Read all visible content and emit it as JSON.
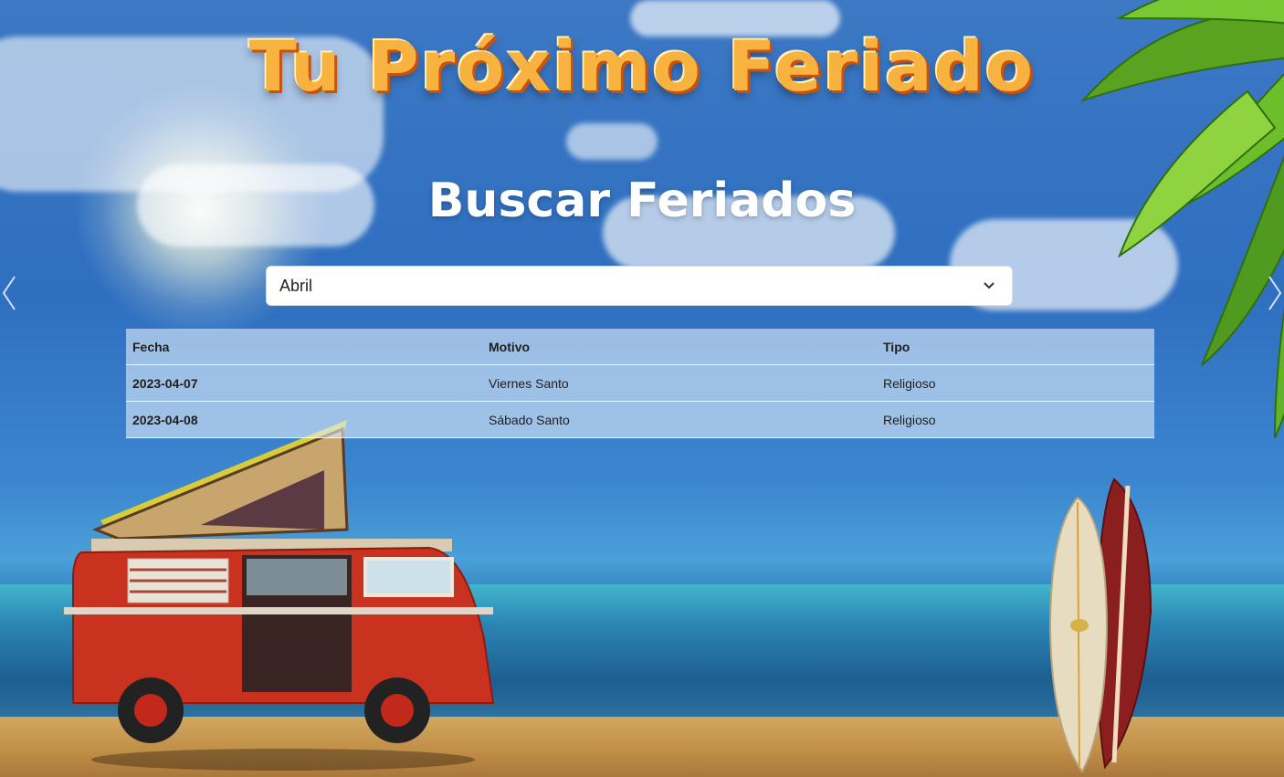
{
  "header": {
    "title": "Tu Próximo Feriado",
    "subtitle": "Buscar Feriados"
  },
  "filter": {
    "selected_month": "Abril"
  },
  "table": {
    "headers": [
      "Fecha",
      "Motivo",
      "Tipo"
    ],
    "rows": [
      {
        "fecha": "2023-04-07",
        "motivo": "Viernes Santo",
        "tipo": "Religioso"
      },
      {
        "fecha": "2023-04-08",
        "motivo": "Sábado Santo",
        "tipo": "Religioso"
      }
    ]
  },
  "icons": {
    "select_chevron": "chevron-down-icon",
    "carousel_prev": "chevron-left-icon",
    "carousel_next": "chevron-right-icon"
  },
  "colors": {
    "title_orange": "#f7b240",
    "sky_blue": "#2f6fc0",
    "table_bg": "#ddecf8",
    "van_red": "#c8321e"
  }
}
